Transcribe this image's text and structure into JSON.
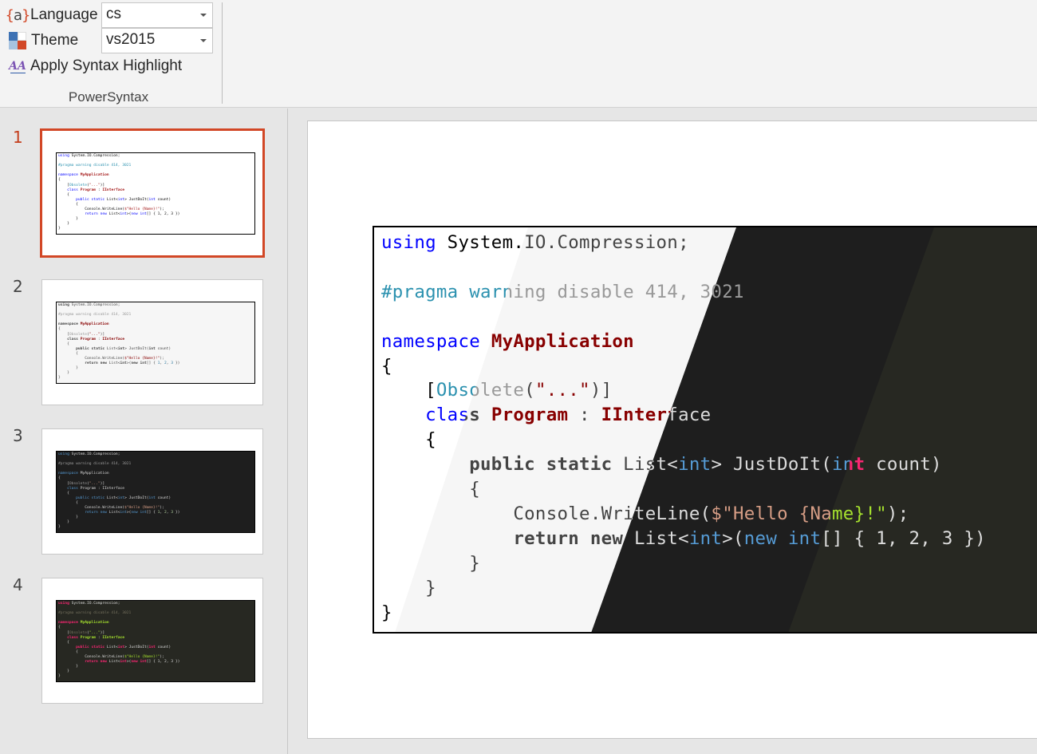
{
  "ribbon": {
    "language_label": "Language",
    "language_value": "cs",
    "theme_label": "Theme",
    "theme_value": "vs2015",
    "apply_label": "Apply Syntax Highlight",
    "group_label": "PowerSyntax",
    "icons": {
      "language": "curly-a-icon",
      "theme": "color-squares-icon",
      "apply": "text-style-icon"
    },
    "icon_glyphs": {
      "lang_open": "{",
      "lang_a": "a",
      "lang_close": "}",
      "apply": "AA"
    }
  },
  "slides": [
    {
      "number": "1",
      "theme": "vs",
      "active": true
    },
    {
      "number": "2",
      "theme": "default",
      "active": false
    },
    {
      "number": "3",
      "theme": "vs2015",
      "active": false
    },
    {
      "number": "4",
      "theme": "monokai-sublime",
      "active": false
    }
  ],
  "colors": {
    "accent": "#d24726",
    "ribbon_bg": "#f3f3f3",
    "pane_bg": "#e6e6e6",
    "themes": {
      "vs": {
        "bg": "#ffffff",
        "text": "#000000",
        "keyword": "#0000ff",
        "type": "#a31515",
        "meta": "#2b91af",
        "string": "#a31515",
        "number": "#000000",
        "attr": "#2b91af"
      },
      "default": {
        "bg": "#f6f6f6",
        "text": "#444444",
        "keyword": "#444444",
        "type": "#880000",
        "meta": "#999999",
        "string": "#880000",
        "number": "#1f7199",
        "attr": "#999999"
      },
      "vs2015": {
        "bg": "#1e1e1e",
        "text": "#dcdcdc",
        "keyword": "#569cd6",
        "type": "#dcdcdc",
        "meta": "#9b9b9b",
        "string": "#d69d85",
        "number": "#b8d7a3",
        "attr": "#9b9b9b"
      },
      "monokai": {
        "bg": "#272822",
        "text": "#dddddd",
        "keyword": "#f92672",
        "type": "#a6e22e",
        "meta": "#75715e",
        "string": "#a6e22e",
        "number": "#dddddd",
        "attr": "#75715e"
      }
    }
  },
  "code": {
    "language": "cs",
    "lines": [
      "using System.IO.Compression;",
      "",
      "#pragma warning disable 414, 3021",
      "",
      "namespace MyApplication",
      "{",
      "    [Obsolete(\"...\")]",
      "    class Program : IInterface",
      "    {",
      "        public static List<int> JustDoIt(int count)",
      "        {",
      "            Console.WriteLine($\"Hello {Name}!\");",
      "            return new List<int>(new int[] { 1, 2, 3 })",
      "        }",
      "    }",
      "}"
    ]
  }
}
